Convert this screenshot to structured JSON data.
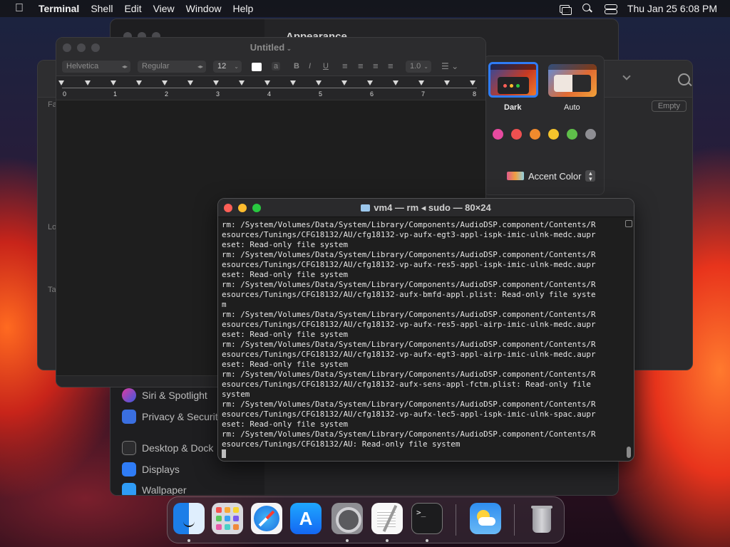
{
  "menubar": {
    "app_name": "Terminal",
    "items": [
      "Shell",
      "Edit",
      "View",
      "Window",
      "Help"
    ],
    "clock": "Thu Jan 25  6:08 PM"
  },
  "settings_window": {
    "title": "Appearance",
    "sidebar": [
      {
        "label": "Siri & Spotlight",
        "color": "#5b3fd6"
      },
      {
        "label": "Privacy & Security",
        "color": "#3a6fe0"
      },
      {
        "label": "Desktop & Dock",
        "color": "#2c2c2e"
      },
      {
        "label": "Displays",
        "color": "#2f7cf6"
      },
      {
        "label": "Wallpaper",
        "color": "#2f9cf6"
      }
    ]
  },
  "back_window": {
    "empty_button": "Empty",
    "letters": [
      "Fa",
      "Lo",
      "Ta"
    ]
  },
  "appearance": {
    "options": [
      "Dark",
      "Auto"
    ],
    "accent_swatches": [
      "#e64aa0",
      "#ee5050",
      "#f18a2d",
      "#f5c42c",
      "#5fbf4a",
      "#8e8e93"
    ],
    "accent_label": "Accent Color"
  },
  "textedit": {
    "title": "Untitled",
    "font": "Helvetica",
    "style": "Regular",
    "size": "12",
    "line_spacing": "1.0",
    "ruler_numbers": [
      "0",
      "1",
      "2",
      "3",
      "4",
      "5",
      "6",
      "7",
      "8"
    ]
  },
  "terminal": {
    "title": "vm4 — rm ◂ sudo — 80×24",
    "lines": [
      "rm: /System/Volumes/Data/System/Library/Components/AudioDSP.component/Contents/R",
      "esources/Tunings/CFG18132/AU/cfg18132-vp-aufx-egt3-appl-ispk-imic-ulnk-medc.aupr",
      "eset: Read-only file system",
      "rm: /System/Volumes/Data/System/Library/Components/AudioDSP.component/Contents/R",
      "esources/Tunings/CFG18132/AU/cfg18132-vp-aufx-res5-appl-ispk-imic-ulnk-medc.aupr",
      "eset: Read-only file system",
      "rm: /System/Volumes/Data/System/Library/Components/AudioDSP.component/Contents/R",
      "esources/Tunings/CFG18132/AU/cfg18132-aufx-bmfd-appl.plist: Read-only file syste",
      "m",
      "rm: /System/Volumes/Data/System/Library/Components/AudioDSP.component/Contents/R",
      "esources/Tunings/CFG18132/AU/cfg18132-vp-aufx-res5-appl-airp-imic-ulnk-medc.aupr",
      "eset: Read-only file system",
      "rm: /System/Volumes/Data/System/Library/Components/AudioDSP.component/Contents/R",
      "esources/Tunings/CFG18132/AU/cfg18132-vp-aufx-egt3-appl-airp-imic-ulnk-medc.aupr",
      "eset: Read-only file system",
      "rm: /System/Volumes/Data/System/Library/Components/AudioDSP.component/Contents/R",
      "esources/Tunings/CFG18132/AU/cfg18132-aufx-sens-appl-fctm.plist: Read-only file",
      "system",
      "rm: /System/Volumes/Data/System/Library/Components/AudioDSP.component/Contents/R",
      "esources/Tunings/CFG18132/AU/cfg18132-vp-aufx-lec5-appl-ispk-imic-ulnk-spac.aupr",
      "eset: Read-only file system",
      "rm: /System/Volumes/Data/System/Library/Components/AudioDSP.component/Contents/R",
      "esources/Tunings/CFG18132/AU: Read-only file system"
    ]
  },
  "dock": {
    "apps": [
      "finder-icon",
      "launchpad-icon",
      "safari-icon",
      "app-store-icon",
      "system-settings-icon",
      "textedit-icon",
      "terminal-icon",
      "weather-icon",
      "trash-icon"
    ],
    "app_store_glyph": "A",
    "terminal_glyph": ">_"
  }
}
